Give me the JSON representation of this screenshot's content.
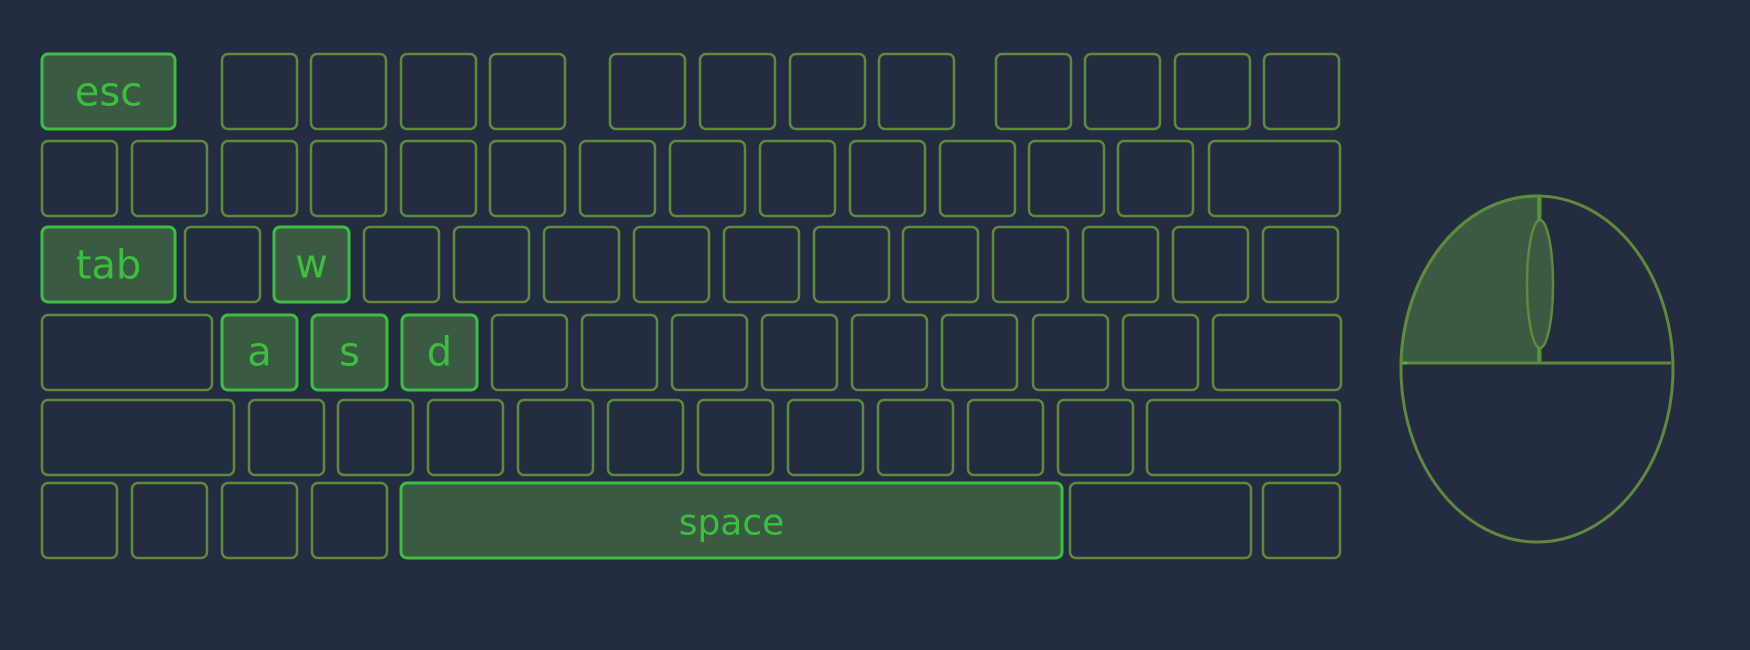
{
  "theme": {
    "background": "#232c41",
    "key_outline": "#5e8a3a",
    "active_outline": "#3cbf3c",
    "active_fill": "#3a5a44",
    "active_text": "#3cbf3c"
  },
  "keyboard": {
    "rows": [
      {
        "keys": [
          {
            "label": "esc",
            "active": true
          },
          {
            "label": ""
          },
          {
            "label": ""
          },
          {
            "label": ""
          },
          {
            "label": ""
          },
          {
            "label": ""
          },
          {
            "label": ""
          },
          {
            "label": ""
          },
          {
            "label": ""
          },
          {
            "label": ""
          },
          {
            "label": ""
          },
          {
            "label": ""
          },
          {
            "label": ""
          }
        ]
      },
      {
        "keys": [
          {
            "label": ""
          },
          {
            "label": ""
          },
          {
            "label": ""
          },
          {
            "label": ""
          },
          {
            "label": ""
          },
          {
            "label": ""
          },
          {
            "label": ""
          },
          {
            "label": ""
          },
          {
            "label": ""
          },
          {
            "label": ""
          },
          {
            "label": ""
          },
          {
            "label": ""
          },
          {
            "label": ""
          },
          {
            "label": ""
          }
        ]
      },
      {
        "keys": [
          {
            "label": "tab",
            "active": true
          },
          {
            "label": ""
          },
          {
            "label": "w",
            "active": true
          },
          {
            "label": ""
          },
          {
            "label": ""
          },
          {
            "label": ""
          },
          {
            "label": ""
          },
          {
            "label": ""
          },
          {
            "label": ""
          },
          {
            "label": ""
          },
          {
            "label": ""
          },
          {
            "label": ""
          },
          {
            "label": ""
          },
          {
            "label": ""
          }
        ]
      },
      {
        "keys": [
          {
            "label": ""
          },
          {
            "label": "a",
            "active": true
          },
          {
            "label": "s",
            "active": true
          },
          {
            "label": "d",
            "active": true
          },
          {
            "label": ""
          },
          {
            "label": ""
          },
          {
            "label": ""
          },
          {
            "label": ""
          },
          {
            "label": ""
          },
          {
            "label": ""
          },
          {
            "label": ""
          },
          {
            "label": ""
          },
          {
            "label": ""
          }
        ]
      },
      {
        "keys": [
          {
            "label": ""
          },
          {
            "label": ""
          },
          {
            "label": ""
          },
          {
            "label": ""
          },
          {
            "label": ""
          },
          {
            "label": ""
          },
          {
            "label": ""
          },
          {
            "label": ""
          },
          {
            "label": ""
          },
          {
            "label": ""
          },
          {
            "label": ""
          },
          {
            "label": ""
          }
        ]
      },
      {
        "keys": [
          {
            "label": ""
          },
          {
            "label": ""
          },
          {
            "label": ""
          },
          {
            "label": ""
          },
          {
            "label": "space",
            "active": true
          },
          {
            "label": ""
          },
          {
            "label": ""
          }
        ]
      }
    ]
  },
  "mouse": {
    "left_button_active": true,
    "right_button_active": false,
    "wheel_active": false
  }
}
